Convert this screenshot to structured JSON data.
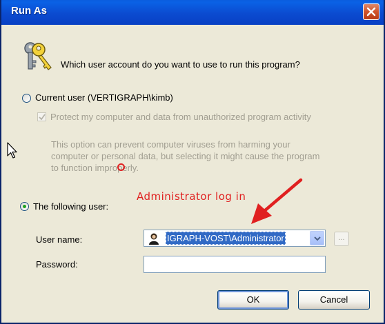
{
  "window": {
    "title": "Run As"
  },
  "prompt": {
    "question": "Which user account do you want to use to run this program?"
  },
  "current_user": {
    "label": "Current user (VERTIGRAPH\\kimb)",
    "selected": false,
    "protect_label": "Protect my computer and data from unauthorized program activity",
    "protect_checked": true,
    "description_lines": [
      "This option can prevent computer viruses from harming your",
      "computer or personal data, but selecting it might cause the program",
      "to function improperly."
    ]
  },
  "following_user": {
    "label": "The following user:",
    "selected": true,
    "username_label": "User name:",
    "username_value": "IGRAPH-VOST\\Administrator",
    "password_label": "Password:",
    "password_value": "",
    "browse_label": "..."
  },
  "annotation": {
    "text": "Administrator log in",
    "color": "#e02020"
  },
  "buttons": {
    "ok": "OK",
    "cancel": "Cancel"
  },
  "icons": {
    "close": "close-icon",
    "keys": "keys-icon",
    "user": "user-icon",
    "dropdown": "chevron-down-icon",
    "cursor": "mouse-cursor-icon",
    "arrow": "annotation-arrow"
  },
  "colors": {
    "titlebar": "#0b4bd0",
    "dialog_bg": "#ece9d8",
    "selection": "#316ac5",
    "disabled_text": "#a19e91"
  }
}
